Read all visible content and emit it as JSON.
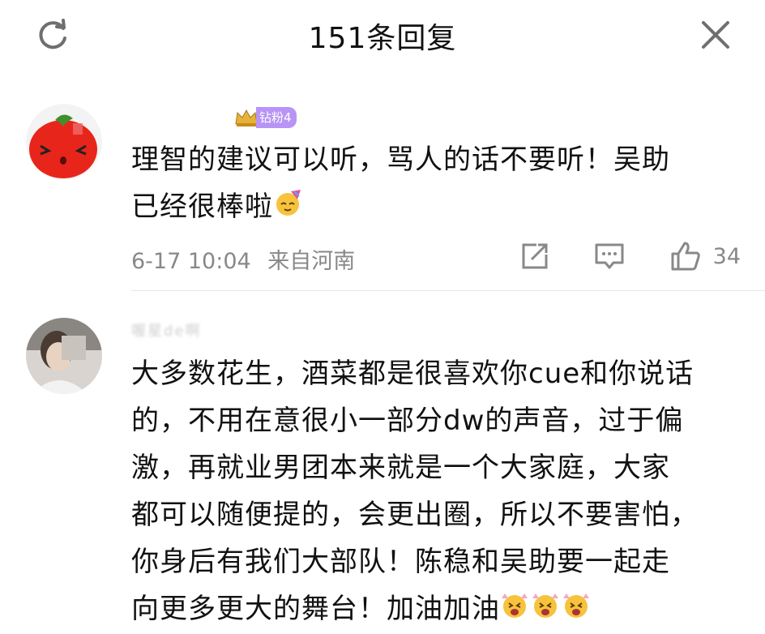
{
  "header": {
    "title": "151条回复"
  },
  "comments": [
    {
      "badge": "钻粉4",
      "text_lines": [
        "理智的建议可以听，骂人的话不要听！吴助",
        "已经很棒啦"
      ],
      "emoji": "party-face-emoji",
      "time": "6-17 10:04",
      "location": "来自河南",
      "likes": "34"
    },
    {
      "username": "喔星de啊",
      "text_lines": [
        "大多数花生，酒菜都是很喜欢你cue和你说话",
        "的，不用在意很小一部分dw的声音，过于偏",
        "激，再就业男团本来就是一个大家庭，大家",
        "都可以随便提的，会更出圈，所以不要害怕，",
        "你身后有我们大部队！陈稳和吴助要一起走",
        "向更多更大的舞台！加油加油"
      ],
      "emoji": "cheering-face-emoji"
    }
  ]
}
